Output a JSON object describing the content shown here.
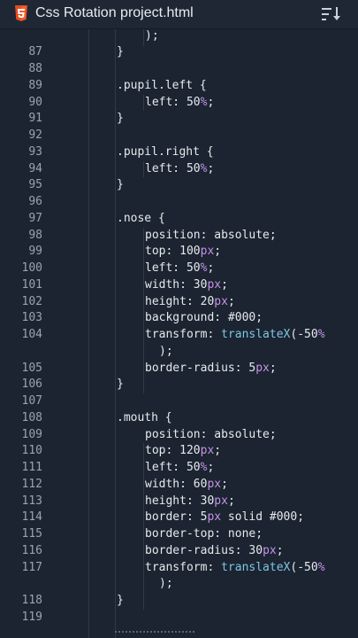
{
  "header": {
    "title": "Css Rotation project.html",
    "file_icon": "html5-icon",
    "menu_icon": "sort-icon"
  },
  "colors": {
    "background": "#1b2430",
    "line_number": "#9aa4b1",
    "unit": "#c792ea",
    "function": "#7ec6e6",
    "text": "#e6e9ee"
  },
  "editor": {
    "lines": [
      {
        "n": "",
        "indent": 2,
        "tokens": [
          {
            "t": ");",
            "c": "k-sel"
          }
        ]
      },
      {
        "n": "87",
        "indent": 1,
        "tokens": [
          {
            "t": "}",
            "c": "k-sel"
          }
        ]
      },
      {
        "n": "88",
        "indent": 0,
        "tokens": []
      },
      {
        "n": "89",
        "indent": 1,
        "tokens": [
          {
            "t": ".pupil.left {",
            "c": "k-sel"
          }
        ]
      },
      {
        "n": "90",
        "indent": 2,
        "tokens": [
          {
            "t": "left: ",
            "c": "k-prop"
          },
          {
            "t": "50",
            "c": "k-num"
          },
          {
            "t": "%",
            "c": "k-unit"
          },
          {
            "t": ";",
            "c": "k-sel"
          }
        ]
      },
      {
        "n": "91",
        "indent": 1,
        "tokens": [
          {
            "t": "}",
            "c": "k-sel"
          }
        ]
      },
      {
        "n": "92",
        "indent": 0,
        "tokens": []
      },
      {
        "n": "93",
        "indent": 1,
        "tokens": [
          {
            "t": ".pupil.right {",
            "c": "k-sel"
          }
        ]
      },
      {
        "n": "94",
        "indent": 2,
        "tokens": [
          {
            "t": "left: ",
            "c": "k-prop"
          },
          {
            "t": "50",
            "c": "k-num"
          },
          {
            "t": "%",
            "c": "k-unit"
          },
          {
            "t": ";",
            "c": "k-sel"
          }
        ]
      },
      {
        "n": "95",
        "indent": 1,
        "tokens": [
          {
            "t": "}",
            "c": "k-sel"
          }
        ]
      },
      {
        "n": "96",
        "indent": 0,
        "tokens": []
      },
      {
        "n": "97",
        "indent": 1,
        "tokens": [
          {
            "t": ".nose {",
            "c": "k-sel"
          }
        ]
      },
      {
        "n": "98",
        "indent": 2,
        "tokens": [
          {
            "t": "position: absolute;",
            "c": "k-prop"
          }
        ]
      },
      {
        "n": "99",
        "indent": 2,
        "tokens": [
          {
            "t": "top: ",
            "c": "k-prop"
          },
          {
            "t": "100",
            "c": "k-num"
          },
          {
            "t": "px",
            "c": "k-unit"
          },
          {
            "t": ";",
            "c": "k-sel"
          }
        ]
      },
      {
        "n": "100",
        "indent": 2,
        "tokens": [
          {
            "t": "left: ",
            "c": "k-prop"
          },
          {
            "t": "50",
            "c": "k-num"
          },
          {
            "t": "%",
            "c": "k-unit"
          },
          {
            "t": ";",
            "c": "k-sel"
          }
        ]
      },
      {
        "n": "101",
        "indent": 2,
        "tokens": [
          {
            "t": "width: ",
            "c": "k-prop"
          },
          {
            "t": "30",
            "c": "k-num"
          },
          {
            "t": "px",
            "c": "k-unit"
          },
          {
            "t": ";",
            "c": "k-sel"
          }
        ]
      },
      {
        "n": "102",
        "indent": 2,
        "tokens": [
          {
            "t": "height: ",
            "c": "k-prop"
          },
          {
            "t": "20",
            "c": "k-num"
          },
          {
            "t": "px",
            "c": "k-unit"
          },
          {
            "t": ";",
            "c": "k-sel"
          }
        ]
      },
      {
        "n": "103",
        "indent": 2,
        "tokens": [
          {
            "t": "background: #000;",
            "c": "k-prop"
          }
        ]
      },
      {
        "n": "104",
        "indent": 2,
        "tokens": [
          {
            "t": "transform: ",
            "c": "k-prop"
          },
          {
            "t": "translateX",
            "c": "k-fn"
          },
          {
            "t": "(-50",
            "c": "k-sel"
          },
          {
            "t": "%",
            "c": "k-unit"
          }
        ]
      },
      {
        "n": "",
        "indent": 2.5,
        "tokens": [
          {
            "t": ");",
            "c": "k-sel"
          }
        ]
      },
      {
        "n": "105",
        "indent": 2,
        "tokens": [
          {
            "t": "border-radius: ",
            "c": "k-prop"
          },
          {
            "t": "5",
            "c": "k-num"
          },
          {
            "t": "px",
            "c": "k-unit"
          },
          {
            "t": ";",
            "c": "k-sel"
          }
        ]
      },
      {
        "n": "106",
        "indent": 1,
        "tokens": [
          {
            "t": "}",
            "c": "k-sel"
          }
        ]
      },
      {
        "n": "107",
        "indent": 0,
        "tokens": []
      },
      {
        "n": "108",
        "indent": 1,
        "tokens": [
          {
            "t": ".mouth {",
            "c": "k-sel"
          }
        ]
      },
      {
        "n": "109",
        "indent": 2,
        "tokens": [
          {
            "t": "position: absolute;",
            "c": "k-prop"
          }
        ]
      },
      {
        "n": "110",
        "indent": 2,
        "tokens": [
          {
            "t": "top: ",
            "c": "k-prop"
          },
          {
            "t": "120",
            "c": "k-num"
          },
          {
            "t": "px",
            "c": "k-unit"
          },
          {
            "t": ";",
            "c": "k-sel"
          }
        ]
      },
      {
        "n": "111",
        "indent": 2,
        "tokens": [
          {
            "t": "left: ",
            "c": "k-prop"
          },
          {
            "t": "50",
            "c": "k-num"
          },
          {
            "t": "%",
            "c": "k-unit"
          },
          {
            "t": ";",
            "c": "k-sel"
          }
        ]
      },
      {
        "n": "112",
        "indent": 2,
        "tokens": [
          {
            "t": "width: ",
            "c": "k-prop"
          },
          {
            "t": "60",
            "c": "k-num"
          },
          {
            "t": "px",
            "c": "k-unit"
          },
          {
            "t": ";",
            "c": "k-sel"
          }
        ]
      },
      {
        "n": "113",
        "indent": 2,
        "tokens": [
          {
            "t": "height: ",
            "c": "k-prop"
          },
          {
            "t": "30",
            "c": "k-num"
          },
          {
            "t": "px",
            "c": "k-unit"
          },
          {
            "t": ";",
            "c": "k-sel"
          }
        ]
      },
      {
        "n": "114",
        "indent": 2,
        "tokens": [
          {
            "t": "border: ",
            "c": "k-prop"
          },
          {
            "t": "5",
            "c": "k-num"
          },
          {
            "t": "px",
            "c": "k-unit"
          },
          {
            "t": " solid #000;",
            "c": "k-sel"
          }
        ]
      },
      {
        "n": "115",
        "indent": 2,
        "tokens": [
          {
            "t": "border-top: none;",
            "c": "k-prop"
          }
        ]
      },
      {
        "n": "116",
        "indent": 2,
        "tokens": [
          {
            "t": "border-radius: ",
            "c": "k-prop"
          },
          {
            "t": "30",
            "c": "k-num"
          },
          {
            "t": "px",
            "c": "k-unit"
          },
          {
            "t": ";",
            "c": "k-sel"
          }
        ]
      },
      {
        "n": "117",
        "indent": 2,
        "tokens": [
          {
            "t": "transform: ",
            "c": "k-prop"
          },
          {
            "t": "translateX",
            "c": "k-fn"
          },
          {
            "t": "(-50",
            "c": "k-sel"
          },
          {
            "t": "%",
            "c": "k-unit"
          }
        ]
      },
      {
        "n": "",
        "indent": 2.5,
        "tokens": [
          {
            "t": ");",
            "c": "k-sel"
          }
        ]
      },
      {
        "n": "118",
        "indent": 1,
        "tokens": [
          {
            "t": "}",
            "c": "k-sel"
          }
        ]
      },
      {
        "n": "119",
        "indent": 0,
        "tokens": []
      }
    ]
  }
}
